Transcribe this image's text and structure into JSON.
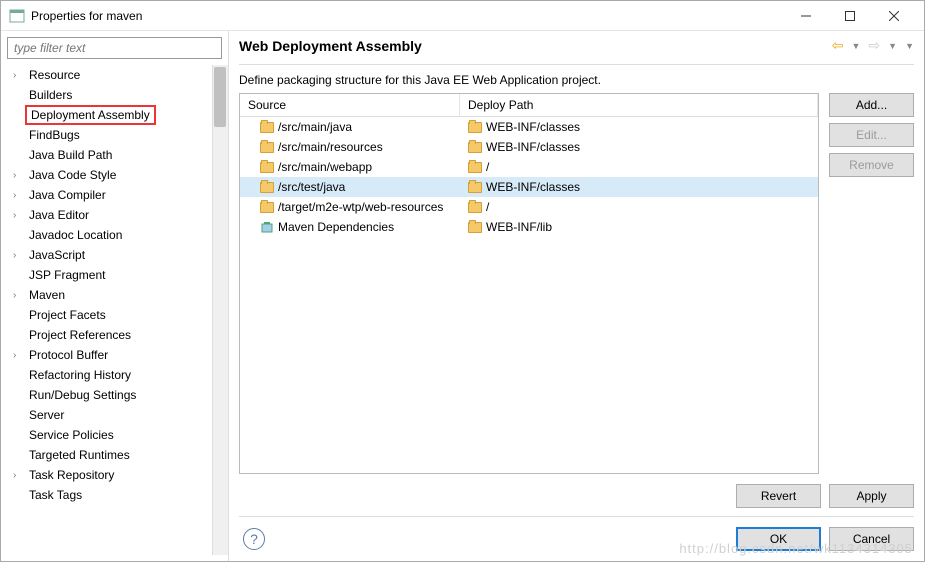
{
  "window": {
    "title": "Properties for maven"
  },
  "filter": {
    "placeholder": "type filter text"
  },
  "tree": [
    {
      "label": "Resource",
      "expandable": true
    },
    {
      "label": "Builders",
      "expandable": false
    },
    {
      "label": "Deployment Assembly",
      "expandable": false,
      "highlighted": true
    },
    {
      "label": "FindBugs",
      "expandable": false
    },
    {
      "label": "Java Build Path",
      "expandable": false
    },
    {
      "label": "Java Code Style",
      "expandable": true
    },
    {
      "label": "Java Compiler",
      "expandable": true
    },
    {
      "label": "Java Editor",
      "expandable": true
    },
    {
      "label": "Javadoc Location",
      "expandable": false
    },
    {
      "label": "JavaScript",
      "expandable": true
    },
    {
      "label": "JSP Fragment",
      "expandable": false
    },
    {
      "label": "Maven",
      "expandable": true
    },
    {
      "label": "Project Facets",
      "expandable": false
    },
    {
      "label": "Project References",
      "expandable": false
    },
    {
      "label": "Protocol Buffer",
      "expandable": true
    },
    {
      "label": "Refactoring History",
      "expandable": false
    },
    {
      "label": "Run/Debug Settings",
      "expandable": false
    },
    {
      "label": "Server",
      "expandable": false
    },
    {
      "label": "Service Policies",
      "expandable": false
    },
    {
      "label": "Targeted Runtimes",
      "expandable": false
    },
    {
      "label": "Task Repository",
      "expandable": true
    },
    {
      "label": "Task Tags",
      "expandable": false
    }
  ],
  "page": {
    "title": "Web Deployment Assembly",
    "description": "Define packaging structure for this Java EE Web Application project."
  },
  "table": {
    "headers": {
      "source": "Source",
      "deploy": "Deploy Path"
    },
    "rows": [
      {
        "icon": "folder",
        "source": "/src/main/java",
        "deploy": "WEB-INF/classes",
        "selected": false
      },
      {
        "icon": "folder",
        "source": "/src/main/resources",
        "deploy": "WEB-INF/classes",
        "selected": false
      },
      {
        "icon": "folder",
        "source": "/src/main/webapp",
        "deploy": "/",
        "selected": false
      },
      {
        "icon": "folder",
        "source": "/src/test/java",
        "deploy": "WEB-INF/classes",
        "selected": true
      },
      {
        "icon": "folder",
        "source": "/target/m2e-wtp/web-resources",
        "deploy": "/",
        "selected": false
      },
      {
        "icon": "jar",
        "source": "Maven Dependencies",
        "deploy": "WEB-INF/lib",
        "selected": false
      }
    ]
  },
  "buttons": {
    "add": "Add...",
    "edit": "Edit...",
    "remove": "Remove",
    "revert": "Revert",
    "apply": "Apply",
    "ok": "OK",
    "cancel": "Cancel"
  },
  "watermark": "http://blog.csdn.net/wk1134314305"
}
